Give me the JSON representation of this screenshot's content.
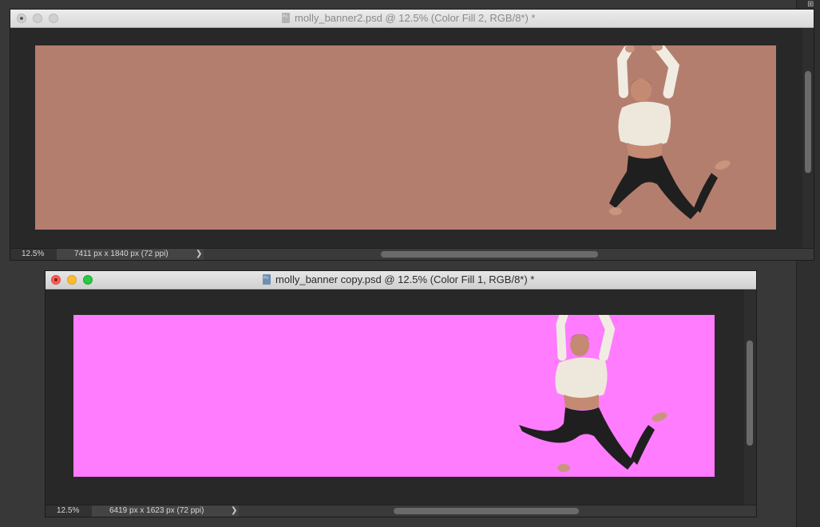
{
  "windows": [
    {
      "title": "molly_banner2.psd @ 12.5% (Color Fill 2, RGB/8*) *",
      "zoom": "12.5%",
      "doc_info": "7411 px x 1840 px (72 ppi)",
      "fill_color": "#b47e6f",
      "active": false
    },
    {
      "title": "molly_banner copy.psd @ 12.5% (Color Fill 1, RGB/8*) *",
      "zoom": "12.5%",
      "doc_info": "6419 px x 1623 px (72 ppi)",
      "fill_color": "#ff7cff",
      "active": true
    }
  ],
  "icons": {
    "close": "close-icon",
    "minimize": "minimize-icon",
    "maximize": "maximize-icon",
    "file": "photoshop-file-icon",
    "arrow": "chevron-right-icon"
  },
  "status_arrow": "❯"
}
